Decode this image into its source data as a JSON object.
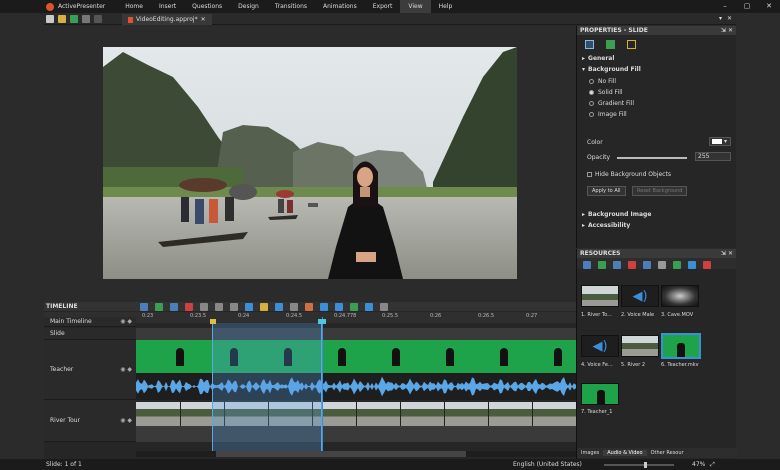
{
  "app": {
    "name": "ActivePresenter"
  },
  "menu": [
    "Home",
    "Insert",
    "Questions",
    "Design",
    "Transitions",
    "Animations",
    "Export",
    "View",
    "Help"
  ],
  "menu_active": "View",
  "window_controls": [
    "–",
    "▢",
    "✕"
  ],
  "doc_tab": {
    "label": "VideoEditing.approj*",
    "close": "✕"
  },
  "properties": {
    "title": "PROPERTIES - SLIDE",
    "sections": {
      "general": "General",
      "background_fill": "Background Fill",
      "background_image": "Background Image",
      "accessibility": "Accessibility"
    },
    "fill_options": [
      "No Fill",
      "Solid Fill",
      "Gradient Fill",
      "Image Fill"
    ],
    "selected_fill": "Solid Fill",
    "color_label": "Color",
    "opacity_label": "Opacity",
    "opacity_value": "255",
    "opacity_fraction": 1.0,
    "hide_bg_label": "Hide Background Objects",
    "apply_all": "Apply to All",
    "reset_bg": "Reset Background"
  },
  "resources": {
    "title": "RESOURCES",
    "items": [
      "1. River To...",
      "2. Voice Male",
      "3. Cave.MOV",
      "4. Voice Fe...",
      "5. River 2",
      "6. Teacher.mkv",
      "7. Teacher_1"
    ],
    "tabs": [
      "Images",
      "Audio & Video",
      "Other Resour"
    ]
  },
  "timeline": {
    "title": "TIMELINE",
    "rows": [
      "Main Timeline",
      "Slide",
      "Teacher",
      "River Tour"
    ],
    "ticks": [
      "0:23",
      "0:23.5",
      "0:24",
      "0:24.5",
      "0:24.778",
      "0:25.5",
      "0:26",
      "0:26.5",
      "0:27"
    ],
    "playhead": "0:24.778"
  },
  "status": {
    "slide": "Slide: 1 of 1",
    "language": "English (United States)",
    "zoom": "47%"
  },
  "colors": {
    "accent": "#3a8fd8",
    "green_screen": "#1fa34a",
    "menubar": "#1b1b1b"
  }
}
